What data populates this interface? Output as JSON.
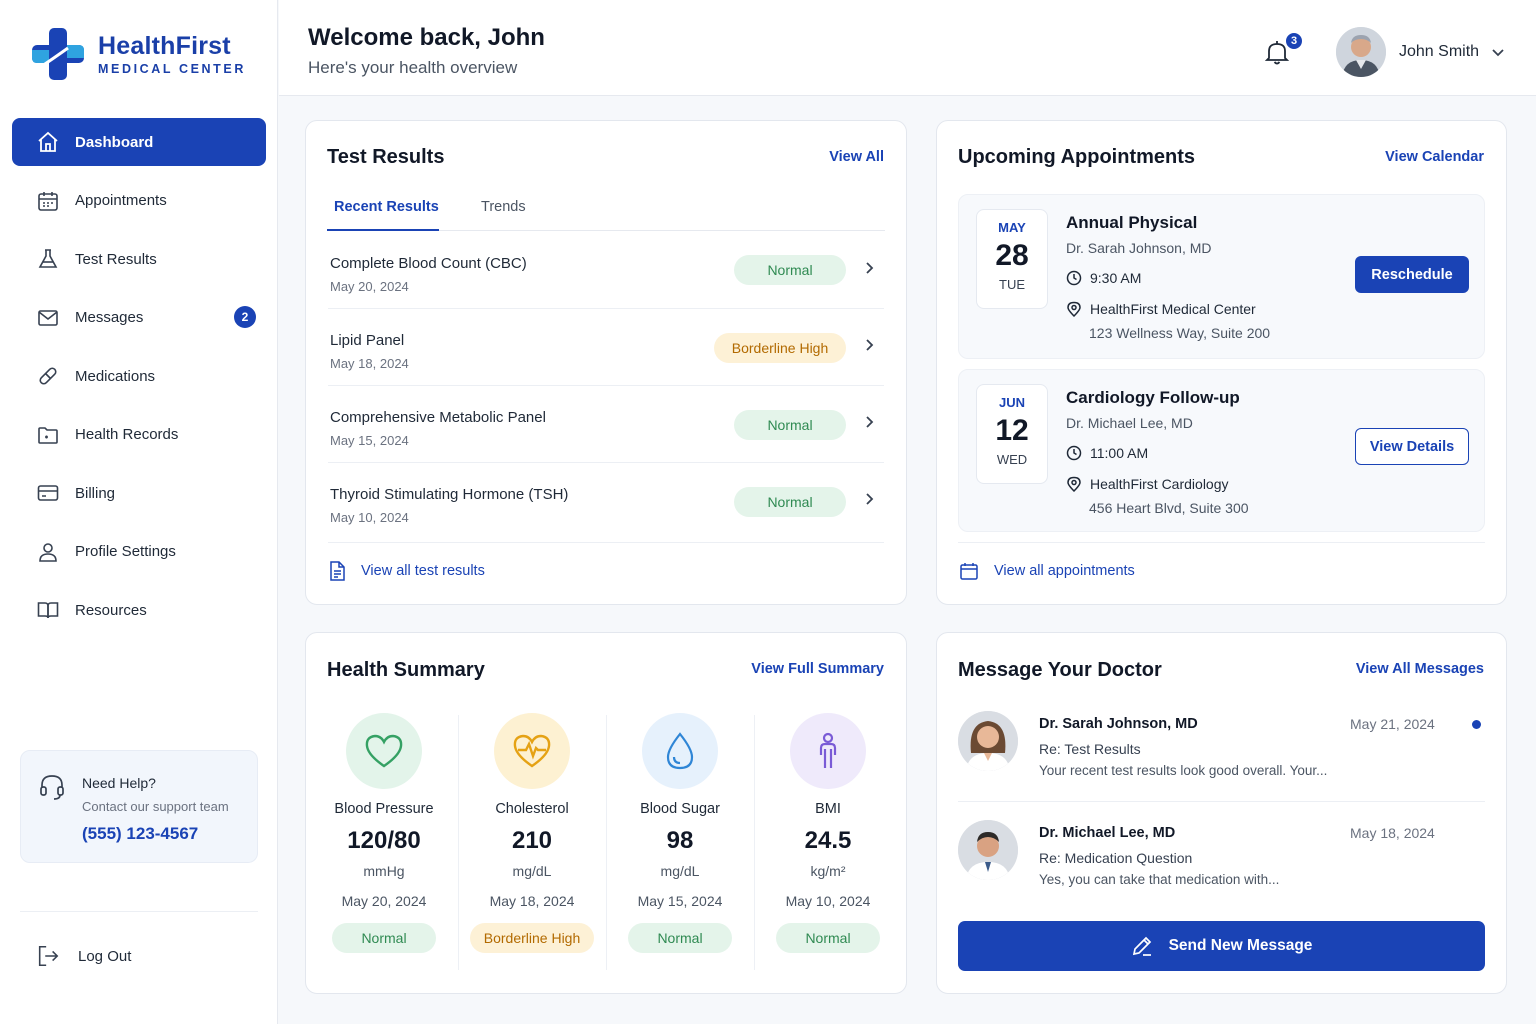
{
  "brand": {
    "name": "HealthFirst",
    "subtitle": "MEDICAL CENTER",
    "color": "#1a43b5"
  },
  "sidebar": {
    "items": [
      {
        "label": "Dashboard",
        "icon": "home-icon",
        "active": true
      },
      {
        "label": "Appointments",
        "icon": "calendar-icon"
      },
      {
        "label": "Test Results",
        "icon": "flask-icon"
      },
      {
        "label": "Messages",
        "icon": "mail-icon",
        "badge": "2"
      },
      {
        "label": "Medications",
        "icon": "pill-icon"
      },
      {
        "label": "Health Records",
        "icon": "folder-icon"
      },
      {
        "label": "Billing",
        "icon": "credit-card-icon"
      },
      {
        "label": "Profile Settings",
        "icon": "user-icon"
      },
      {
        "label": "Resources",
        "icon": "book-icon"
      }
    ],
    "help": {
      "title": "Need Help?",
      "subtitle": "Contact our support team",
      "phone": "(555) 123-4567"
    },
    "logout": "Log Out"
  },
  "header": {
    "title": "Welcome back, John",
    "subtitle": "Here's your health overview",
    "notifications": "3",
    "user_name": "John Smith"
  },
  "test_results": {
    "title": "Test Results",
    "view_all": "View All",
    "tabs": [
      "Recent Results",
      "Trends"
    ],
    "rows": [
      {
        "name": "Complete Blood Count (CBC)",
        "date": "May 20, 2024",
        "status": "Normal",
        "kind": "normal"
      },
      {
        "name": "Lipid Panel",
        "date": "May 18, 2024",
        "status": "Borderline High",
        "kind": "border"
      },
      {
        "name": "Comprehensive Metabolic Panel",
        "date": "May 15, 2024",
        "status": "Normal",
        "kind": "normal"
      },
      {
        "name": "Thyroid Stimulating Hormone (TSH)",
        "date": "May 10, 2024",
        "status": "Normal",
        "kind": "normal"
      }
    ],
    "footer": "View all test results"
  },
  "appointments": {
    "title": "Upcoming Appointments",
    "view_calendar": "View Calendar",
    "items": [
      {
        "month": "MAY",
        "day": "28",
        "dow": "TUE",
        "title": "Annual Physical",
        "doctor": "Dr. Sarah Johnson, MD",
        "time": "9:30 AM",
        "location": "HealthFirst Medical Center",
        "address": "123 Wellness Way, Suite 200",
        "action": "Reschedule"
      },
      {
        "month": "JUN",
        "day": "12",
        "dow": "WED",
        "title": "Cardiology Follow-up",
        "doctor": "Dr. Michael Lee, MD",
        "time": "11:00 AM",
        "location": "HealthFirst Cardiology",
        "address": "456 Heart Blvd, Suite 300",
        "action": "View Details"
      }
    ],
    "footer": "View all appointments"
  },
  "health_summary": {
    "title": "Health Summary",
    "view_full": "View Full Summary",
    "metrics": [
      {
        "name": "Blood Pressure",
        "value": "120/80",
        "unit": "mmHg",
        "date": "May 20, 2024",
        "status": "Normal",
        "kind": "normal"
      },
      {
        "name": "Cholesterol",
        "value": "210",
        "unit": "mg/dL",
        "date": "May 18, 2024",
        "status": "Borderline High",
        "kind": "border"
      },
      {
        "name": "Blood Sugar",
        "value": "98",
        "unit": "mg/dL",
        "date": "May 15, 2024",
        "status": "Normal",
        "kind": "normal"
      },
      {
        "name": "BMI",
        "value": "24.5",
        "unit": "kg/m²",
        "date": "May 10, 2024",
        "status": "Normal",
        "kind": "normal"
      }
    ]
  },
  "messages": {
    "title": "Message Your Doctor",
    "view_all": "View All Messages",
    "items": [
      {
        "from": "Dr. Sarah Johnson, MD",
        "date": "May 21, 2024",
        "subject": "Re: Test Results",
        "preview": "Your recent test results look good overall. Your...",
        "unread": true
      },
      {
        "from": "Dr. Michael Lee, MD",
        "date": "May 18, 2024",
        "subject": "Re: Medication Question",
        "preview": "Yes, you can take that medication with...",
        "unread": false
      }
    ],
    "send": "Send New Message"
  }
}
